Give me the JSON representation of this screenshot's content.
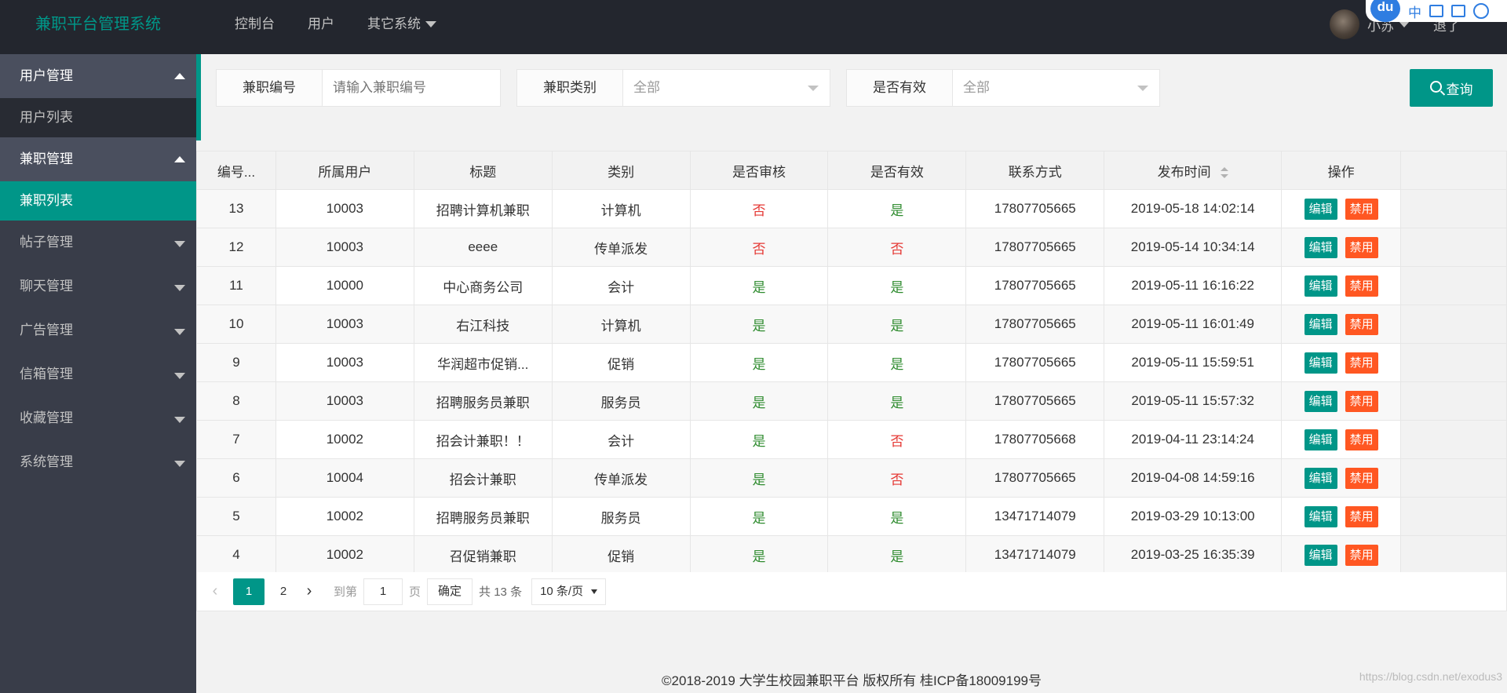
{
  "header": {
    "logo": "兼职平台管理系统",
    "nav": [
      {
        "label": "控制台",
        "dropdown": false
      },
      {
        "label": "用户",
        "dropdown": false
      },
      {
        "label": "其它系统",
        "dropdown": true
      }
    ],
    "username": "小苏",
    "logout": "退了"
  },
  "ime": {
    "logo": "du",
    "mode": "中"
  },
  "sidebar": {
    "groups": [
      {
        "label": "用户管理",
        "open": true,
        "children": [
          {
            "label": "用户列表",
            "active": false
          }
        ]
      },
      {
        "label": "兼职管理",
        "open": true,
        "children": [
          {
            "label": "兼职列表",
            "active": true
          }
        ]
      },
      {
        "label": "帖子管理",
        "open": false
      },
      {
        "label": "聊天管理",
        "open": false
      },
      {
        "label": "广告管理",
        "open": false
      },
      {
        "label": "信箱管理",
        "open": false
      },
      {
        "label": "收藏管理",
        "open": false
      },
      {
        "label": "系统管理",
        "open": false
      }
    ]
  },
  "search": {
    "id_label": "兼职编号",
    "id_placeholder": "请输入兼职编号",
    "type_label": "兼职类别",
    "type_value": "全部",
    "valid_label": "是否有效",
    "valid_value": "全部",
    "query_label": "查询"
  },
  "table": {
    "headers": [
      "编号...",
      "所属用户",
      "标题",
      "类别",
      "是否审核",
      "是否有效",
      "联系方式",
      "发布时间",
      "操作"
    ],
    "edit_label": "编辑",
    "ban_label": "禁用",
    "rows": [
      {
        "id": "13",
        "user": "10003",
        "title": "招聘计算机兼职",
        "category": "计算机",
        "audited": "否",
        "valid": "是",
        "contact": "17807705665",
        "time": "2019-05-18 14:02:14"
      },
      {
        "id": "12",
        "user": "10003",
        "title": "eeee",
        "category": "传单派发",
        "audited": "否",
        "valid": "否",
        "contact": "17807705665",
        "time": "2019-05-14 10:34:14"
      },
      {
        "id": "11",
        "user": "10000",
        "title": "中心商务公司",
        "category": "会计",
        "audited": "是",
        "valid": "是",
        "contact": "17807705665",
        "time": "2019-05-11 16:16:22"
      },
      {
        "id": "10",
        "user": "10003",
        "title": "右江科技",
        "category": "计算机",
        "audited": "是",
        "valid": "是",
        "contact": "17807705665",
        "time": "2019-05-11 16:01:49"
      },
      {
        "id": "9",
        "user": "10003",
        "title": "华润超市促销...",
        "category": "促销",
        "audited": "是",
        "valid": "是",
        "contact": "17807705665",
        "time": "2019-05-11 15:59:51"
      },
      {
        "id": "8",
        "user": "10003",
        "title": "招聘服务员兼职",
        "category": "服务员",
        "audited": "是",
        "valid": "是",
        "contact": "17807705665",
        "time": "2019-05-11 15:57:32"
      },
      {
        "id": "7",
        "user": "10002",
        "title": "招会计兼职！！",
        "category": "会计",
        "audited": "是",
        "valid": "否",
        "contact": "17807705668",
        "time": "2019-04-11 23:14:24"
      },
      {
        "id": "6",
        "user": "10004",
        "title": "招会计兼职",
        "category": "传单派发",
        "audited": "是",
        "valid": "否",
        "contact": "17807705665",
        "time": "2019-04-08 14:59:16"
      },
      {
        "id": "5",
        "user": "10002",
        "title": "招聘服务员兼职",
        "category": "服务员",
        "audited": "是",
        "valid": "是",
        "contact": "13471714079",
        "time": "2019-03-29 10:13:00"
      },
      {
        "id": "4",
        "user": "10002",
        "title": "召促销兼职",
        "category": "促销",
        "audited": "是",
        "valid": "是",
        "contact": "13471714079",
        "time": "2019-03-25 16:35:39"
      }
    ]
  },
  "pager": {
    "prev": "‹",
    "next": "›",
    "pages": [
      "1",
      "2"
    ],
    "current": "1",
    "goto_label": "到第",
    "goto_value": "1",
    "page_label": "页",
    "ok_label": "确定",
    "count_label": "共 13 条",
    "size_value": "10 条/页"
  },
  "footer": "©2018-2019 大学生校园兼职平台 版权所有 桂ICP备18009199号",
  "watermark": "https://blog.csdn.net/exodus3",
  "colors": {
    "primary": "#009688",
    "danger": "#ff5722",
    "no": "#e53935",
    "yes": "#2e8b2e",
    "sidebar": "#393d49",
    "header": "#23262e"
  }
}
